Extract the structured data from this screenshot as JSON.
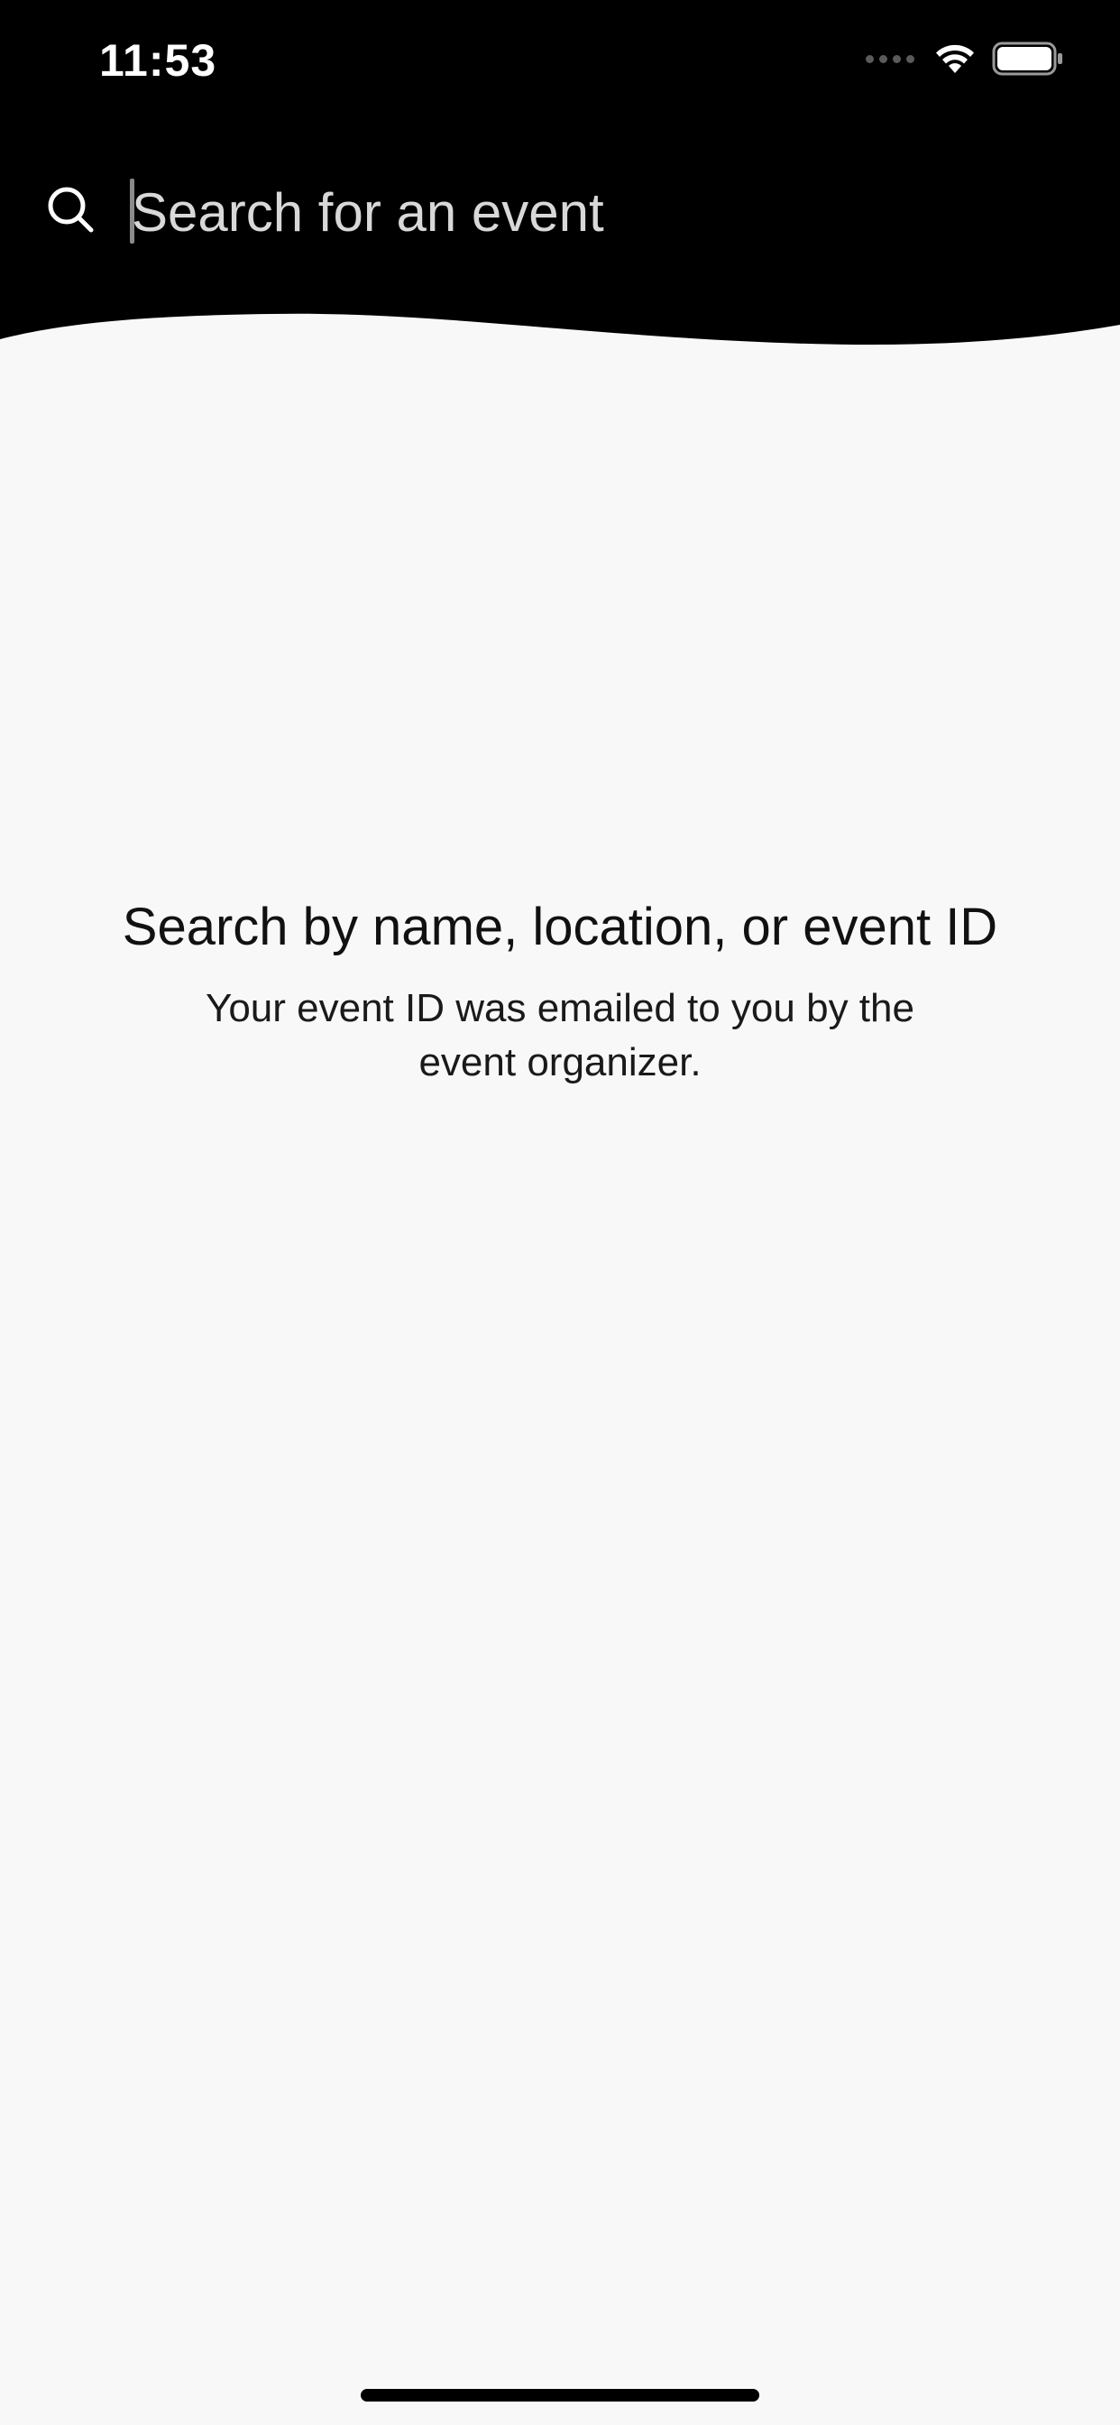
{
  "status_bar": {
    "time": "11:53",
    "icons": [
      "cellular-signal-icon",
      "wifi-icon",
      "battery-icon"
    ]
  },
  "search": {
    "placeholder": "Search for an event",
    "value": ""
  },
  "empty_state": {
    "title": "Search by name, location, or event ID",
    "subtitle": "Your event ID was emailed to you by the event organizer."
  },
  "colors": {
    "header_background": "#000000",
    "page_background": "#f8f8f8",
    "text_primary": "#111111"
  }
}
